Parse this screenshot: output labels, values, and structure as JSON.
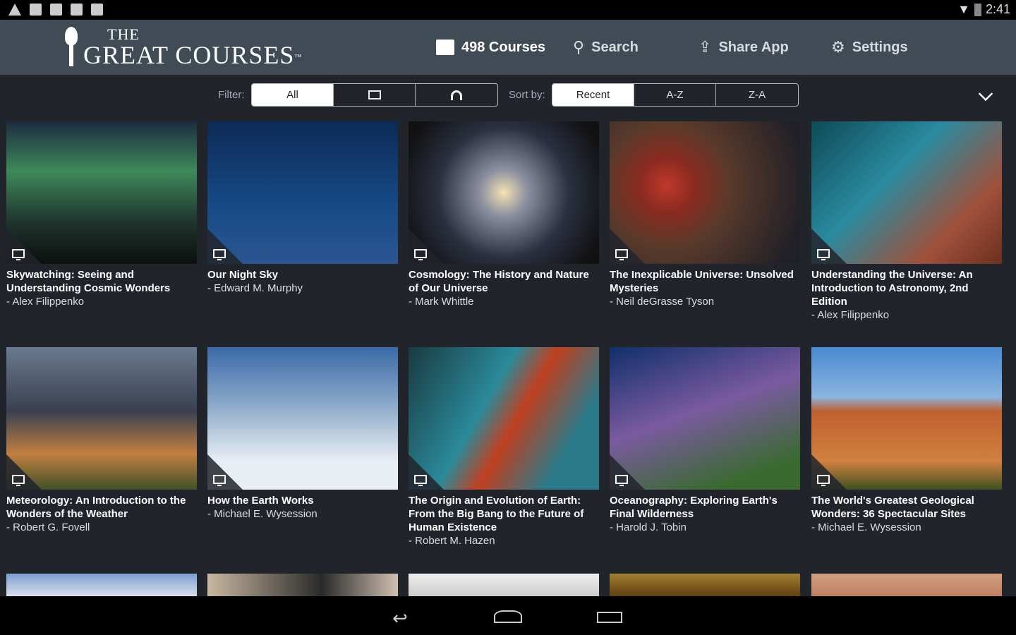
{
  "status_bar": {
    "time": "2:41"
  },
  "header": {
    "logo_the": "THE",
    "logo_name": "GREAT COURSES",
    "logo_tm": "™",
    "courses_label": "498 Courses",
    "search_label": "Search",
    "share_label": "Share App",
    "settings_label": "Settings"
  },
  "filter": {
    "label": "Filter:",
    "options": [
      "All",
      "video",
      "audio"
    ]
  },
  "sort": {
    "label": "Sort by:",
    "options": [
      "Recent",
      "A-Z",
      "Z-A"
    ]
  },
  "courses": [
    {
      "title": "Skywatching: Seeing and Understanding Cosmic Wonders",
      "author": "- Alex Filippenko"
    },
    {
      "title": "Our Night Sky",
      "author": "- Edward M. Murphy"
    },
    {
      "title": "Cosmology: The History and Nature of Our Universe",
      "author": "- Mark Whittle"
    },
    {
      "title": "The Inexplicable Universe: Unsolved Mysteries",
      "author": "- Neil deGrasse Tyson"
    },
    {
      "title": "Understanding the Universe: An Introduction to Astronomy, 2nd Edition",
      "author": "- Alex Filippenko"
    },
    {
      "title": "Meteorology: An Introduction to the Wonders of the Weather",
      "author": "- Robert G. Fovell"
    },
    {
      "title": "How the Earth Works",
      "author": "- Michael E. Wysession"
    },
    {
      "title": "The Origin and Evolution of Earth: From the Big Bang to the Future of Human Existence",
      "author": "- Robert M. Hazen"
    },
    {
      "title": "Oceanography: Exploring Earth's Final Wilderness",
      "author": "- Harold J. Tobin"
    },
    {
      "title": "The World's Greatest Geological Wonders: 36 Spectacular Sites",
      "author": "- Michael E. Wysession"
    }
  ]
}
